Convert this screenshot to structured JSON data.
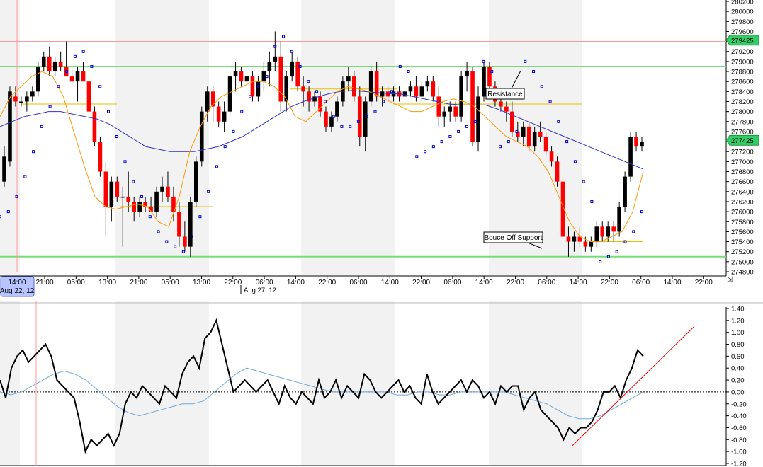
{
  "colors": {
    "bull": "#000000",
    "bear": "#ff0000",
    "ma_slow": "#3333cc",
    "ma_fast": "#ff9900",
    "sar": "#0000cc",
    "support_resistance": "#77dd77",
    "top_line": "#ff8888",
    "level_lines": "#e6c200",
    "oscillator": "#000000",
    "oscillator_signal": "#6fa8dc",
    "trendline": "#ff0000",
    "marker_bg": "#b8c4ff",
    "price_tag_bg": "#33cc66",
    "band": "#f2f2f2"
  },
  "price_panel": {
    "y_ticks": [
      "280200",
      "280000",
      "279800",
      "279600",
      "279400",
      "279200",
      "279000",
      "278800",
      "278600",
      "278400",
      "278200",
      "278000",
      "277800",
      "277600",
      "277400",
      "277200",
      "277000",
      "276800",
      "276600",
      "276400",
      "276200",
      "276000",
      "275800",
      "275600",
      "275400",
      "275200",
      "275000",
      "274800"
    ],
    "price_tags": [
      "279425",
      "277425"
    ],
    "x_ticks": [
      "21:00",
      "05:00",
      "13:00",
      "21:00",
      "05:00",
      "13:00",
      "22:00",
      "06:00",
      "14:00",
      "22:00",
      "06:00",
      "14:00",
      "22:00",
      "06:00",
      "14:00",
      "22:00",
      "06:00",
      "14:00",
      "22:00",
      "06:00",
      "14:00",
      "22:00"
    ],
    "date_marker": "14:00\nAug 22, 12",
    "date_label": "Aug 27, 12",
    "annotations": [
      "Resistance",
      "Bouce Off Support"
    ]
  },
  "osc_panel": {
    "y_ticks": [
      "1.40",
      "1.20",
      "1.00",
      "0.80",
      "0.60",
      "0.40",
      "0.20",
      "0.00",
      "-0.20",
      "-0.40",
      "-0.60",
      "-0.80",
      "-1.00",
      "-1.20"
    ]
  },
  "chart_data": [
    {
      "type": "candlestick",
      "ylim": [
        274800,
        280200
      ],
      "levels": {
        "resistance": 278900,
        "support": 275100,
        "top_line": 279400
      },
      "candles": [
        [
          276600,
          277300,
          276500,
          277100
        ],
        [
          277000,
          278500,
          276900,
          278400
        ],
        [
          278300,
          278500,
          278100,
          278200
        ],
        [
          278200,
          278300,
          278100,
          278200
        ],
        [
          278200,
          278400,
          278000,
          278300
        ],
        [
          278300,
          278500,
          278200,
          278400
        ],
        [
          278400,
          279000,
          278300,
          278900
        ],
        [
          278900,
          279200,
          278800,
          279100
        ],
        [
          279100,
          279300,
          278700,
          278800
        ],
        [
          278800,
          279100,
          278700,
          279000
        ],
        [
          279000,
          279200,
          278800,
          278900
        ],
        [
          278900,
          279400,
          278800,
          278700
        ],
        [
          278700,
          278900,
          278500,
          278600
        ],
        [
          278600,
          278900,
          278200,
          278800
        ],
        [
          278800,
          279000,
          278700,
          278600
        ],
        [
          278600,
          278800,
          277900,
          278000
        ],
        [
          278000,
          278100,
          277300,
          277400
        ],
        [
          277400,
          277500,
          276700,
          276800
        ],
        [
          276800,
          277000,
          275500,
          276100
        ],
        [
          276100,
          276700,
          275800,
          276600
        ],
        [
          276600,
          276700,
          276200,
          276300
        ],
        [
          276300,
          276500,
          275300,
          276300
        ],
        [
          276300,
          276800,
          276000,
          276200
        ],
        [
          276200,
          276300,
          275800,
          276000
        ],
        [
          276000,
          276300,
          275900,
          276200
        ],
        [
          276200,
          276300,
          276000,
          276100
        ],
        [
          276100,
          276300,
          276000,
          276000
        ],
        [
          276000,
          276500,
          275900,
          276400
        ],
        [
          276400,
          276700,
          276200,
          276500
        ],
        [
          276500,
          276800,
          276200,
          276300
        ],
        [
          276300,
          276500,
          275800,
          276000
        ],
        [
          276000,
          276200,
          275300,
          275500
        ],
        [
          275500,
          275800,
          275200,
          275300
        ],
        [
          275300,
          276300,
          275100,
          276200
        ],
        [
          276200,
          277100,
          276100,
          277000
        ],
        [
          277000,
          278100,
          276900,
          278000
        ],
        [
          278000,
          278500,
          277800,
          278400
        ],
        [
          278400,
          278500,
          277800,
          278100
        ],
        [
          278100,
          278200,
          277700,
          277800
        ],
        [
          277800,
          278200,
          277600,
          278000
        ],
        [
          278000,
          278800,
          277900,
          278700
        ],
        [
          278700,
          279000,
          278400,
          278800
        ],
        [
          278800,
          278900,
          278500,
          278600
        ],
        [
          278600,
          278900,
          278400,
          278700
        ],
        [
          278700,
          278800,
          278200,
          278300
        ],
        [
          278300,
          278700,
          278200,
          278600
        ],
        [
          278600,
          279000,
          278400,
          278800
        ],
        [
          278800,
          279200,
          278500,
          279000
        ],
        [
          279000,
          279600,
          278800,
          279100
        ],
        [
          279100,
          279400,
          278000,
          278200
        ],
        [
          278200,
          278800,
          278000,
          278700
        ],
        [
          278700,
          279200,
          278600,
          279000
        ],
        [
          279000,
          279100,
          278400,
          278500
        ],
        [
          278500,
          278700,
          278100,
          278400
        ],
        [
          278400,
          278500,
          278000,
          278200
        ],
        [
          278200,
          278400,
          278100,
          278300
        ],
        [
          278300,
          278400,
          277900,
          278000
        ],
        [
          278000,
          278100,
          277600,
          277700
        ],
        [
          277700,
          278000,
          277600,
          277900
        ],
        [
          277900,
          278300,
          277800,
          278200
        ],
        [
          278200,
          278700,
          278100,
          278600
        ],
        [
          278600,
          278900,
          278400,
          278700
        ],
        [
          278700,
          278800,
          278200,
          278300
        ],
        [
          278300,
          278500,
          277300,
          277500
        ],
        [
          277500,
          278300,
          277200,
          278200
        ],
        [
          278200,
          278900,
          278100,
          278800
        ],
        [
          278800,
          279000,
          278200,
          278300
        ],
        [
          278300,
          278500,
          278100,
          278400
        ],
        [
          278400,
          278500,
          278200,
          278300
        ],
        [
          278300,
          278500,
          278200,
          278400
        ],
        [
          278400,
          278500,
          278200,
          278300
        ],
        [
          278300,
          278400,
          278200,
          278400
        ],
        [
          278400,
          278600,
          278300,
          278500
        ],
        [
          278500,
          278700,
          278200,
          278300
        ],
        [
          278300,
          278600,
          278200,
          278500
        ],
        [
          278500,
          278700,
          278400,
          278600
        ],
        [
          278600,
          278700,
          278200,
          278300
        ],
        [
          278300,
          278500,
          277700,
          277900
        ],
        [
          277900,
          278100,
          277700,
          278000
        ],
        [
          278000,
          278200,
          277800,
          278100
        ],
        [
          278100,
          278200,
          277800,
          277900
        ],
        [
          277900,
          278800,
          277800,
          278700
        ],
        [
          278700,
          279000,
          278400,
          278800
        ],
        [
          278800,
          278900,
          277300,
          277400
        ],
        [
          277400,
          278500,
          277200,
          278300
        ],
        [
          278300,
          279000,
          278200,
          278900
        ],
        [
          278900,
          279000,
          278400,
          278500
        ],
        [
          278500,
          278600,
          278100,
          278200
        ],
        [
          278200,
          278300,
          278000,
          278100
        ],
        [
          278100,
          278200,
          277800,
          278000
        ],
        [
          278000,
          278200,
          277500,
          277600
        ],
        [
          277600,
          277800,
          277400,
          277500
        ],
        [
          277500,
          277800,
          277300,
          277700
        ],
        [
          277700,
          277800,
          277200,
          277300
        ],
        [
          277300,
          277700,
          277200,
          277600
        ],
        [
          277600,
          277800,
          277400,
          277500
        ],
        [
          277500,
          277600,
          277100,
          277200
        ],
        [
          277200,
          277300,
          276900,
          277000
        ],
        [
          277000,
          277100,
          276500,
          276600
        ],
        [
          276600,
          276700,
          275300,
          275500
        ],
        [
          275500,
          275700,
          275100,
          275400
        ],
        [
          275400,
          275600,
          275200,
          275500
        ],
        [
          275500,
          275700,
          275300,
          275400
        ],
        [
          275400,
          275500,
          275200,
          275300
        ],
        [
          275300,
          275500,
          275200,
          275400
        ],
        [
          275400,
          275800,
          275300,
          275700
        ],
        [
          275700,
          275800,
          275400,
          275500
        ],
        [
          275500,
          275800,
          275400,
          275700
        ],
        [
          275700,
          275800,
          275400,
          275600
        ],
        [
          275600,
          276200,
          275500,
          276100
        ],
        [
          276100,
          276800,
          276000,
          276700
        ],
        [
          276700,
          277600,
          276600,
          277500
        ],
        [
          277500,
          277600,
          277200,
          277300
        ],
        [
          277300,
          277500,
          277200,
          277400
        ]
      ],
      "ma_slow": [
        277700,
        277800,
        277900,
        277950,
        278000,
        278000,
        277950,
        277900,
        277850,
        277750,
        277600,
        277450,
        277300,
        277250,
        277200,
        277200,
        277200,
        277250,
        277300,
        277400,
        277500,
        277650,
        277800,
        277950,
        278100,
        278200,
        278280,
        278350,
        278400,
        278420,
        278400,
        278380,
        278360,
        278350,
        278300,
        278250,
        278200,
        278150,
        278130,
        278130,
        278130,
        278050,
        277950,
        277850,
        277750,
        277650,
        277550,
        277450,
        277350,
        277250,
        277150,
        277050,
        276950,
        276850
      ],
      "ma_fast": [
        277900,
        278300,
        278500,
        278700,
        278800,
        278700,
        278300,
        277600,
        276900,
        276300,
        276100,
        276050,
        276100,
        276150,
        276100,
        275800,
        275700,
        276300,
        277200,
        277700,
        278100,
        278300,
        278400,
        278500,
        278600,
        278600,
        278500,
        278300,
        277900,
        277800,
        278000,
        278200,
        278400,
        278500,
        278450,
        278400,
        278300,
        278200,
        278100,
        278000,
        278000,
        278100,
        278200,
        278250,
        278200,
        278100,
        277900,
        277700,
        277500,
        277400,
        277300,
        277100,
        276800,
        276300,
        275800,
        275500,
        275400,
        275400,
        275500,
        275600,
        276000,
        276800
      ],
      "sar": [
        275900,
        276000,
        276300,
        276700,
        277200,
        277700,
        278100,
        278500,
        278800,
        279100,
        279200,
        278900,
        278500,
        278000,
        277500,
        277000,
        276600,
        276300,
        275900,
        275600,
        275400,
        275300,
        275200,
        275500,
        275900,
        276400,
        276900,
        277300,
        277600,
        278000,
        278300,
        278500,
        278700,
        279300,
        279500,
        279200,
        278900,
        278600,
        278400,
        278200,
        277900,
        277700,
        277700,
        277800,
        277900,
        278000,
        278200,
        278400,
        278900,
        278800,
        277100,
        277200,
        277300,
        277400,
        277500,
        277600,
        277700,
        277800,
        279000,
        278800,
        277300,
        277400,
        277600,
        279000,
        278800,
        278500,
        278200,
        277800,
        277400,
        277000,
        276600,
        276200,
        275000,
        275100,
        275200,
        275400,
        275600,
        276000
      ]
    },
    {
      "type": "line",
      "ylim": [
        -1.2,
        1.4
      ],
      "series": [
        {
          "values": [
            0.2,
            -0.1,
            0.4,
            0.6,
            0.7,
            0.5,
            0.6,
            0.7,
            0.8,
            0.6,
            0.2,
            0.1,
            0.0,
            -0.1,
            -0.5,
            -1.0,
            -0.8,
            -0.9,
            -0.8,
            -0.7,
            -0.9,
            -0.7,
            -0.2,
            0.0,
            -0.1,
            0.1,
            0.0,
            -0.1,
            -0.2,
            0.1,
            0.0,
            -0.1,
            0.3,
            0.5,
            0.6,
            0.4,
            0.9,
            1.0,
            1.2,
            0.8,
            0.4,
            0.0,
            0.1,
            0.2,
            0.1,
            0.0,
            0.1,
            0.2,
            0.0,
            -0.2,
            0.1,
            -0.1,
            -0.2,
            0.0,
            -0.1,
            -0.2,
            0.2,
            -0.1,
            0.0,
            0.2,
            -0.1,
            0.1,
            0.0,
            -0.1,
            0.3,
            0.2,
            0.0,
            -0.1,
            0.0,
            0.1,
            0.2,
            0.0,
            0.1,
            -0.1,
            -0.2,
            0.3,
            0.0,
            -0.2,
            -0.1,
            0.0,
            0.1,
            0.2,
            0.0,
            0.2,
            0.1,
            -0.1,
            0.0,
            -0.2,
            0.1,
            0.0,
            0.1,
            0.1,
            -0.3,
            -0.1,
            0.0,
            -0.3,
            -0.4,
            -0.5,
            -0.6,
            -0.8,
            -0.6,
            -0.7,
            -0.6,
            -0.6,
            -0.5,
            -0.3,
            0.0,
            0.0,
            0.1,
            -0.1,
            0.2,
            0.4,
            0.7,
            0.6
          ]
        },
        {
          "values": [
            0.0,
            -0.05,
            0.0,
            0.1,
            0.2,
            0.3,
            0.35,
            0.3,
            0.2,
            0.05,
            -0.1,
            -0.25,
            -0.35,
            -0.4,
            -0.35,
            -0.3,
            -0.25,
            -0.2,
            -0.2,
            -0.15,
            0.0,
            0.15,
            0.3,
            0.4,
            0.35,
            0.3,
            0.25,
            0.2,
            0.15,
            0.1,
            0.05,
            0.0,
            0.0,
            0.0,
            0.0,
            0.0,
            0.0,
            -0.05,
            -0.05,
            0.0,
            0.0,
            -0.05,
            -0.05,
            0.0,
            0.0,
            0.0,
            0.0,
            0.0,
            -0.05,
            -0.1,
            -0.15,
            -0.2,
            -0.3,
            -0.4,
            -0.45,
            -0.45,
            -0.4,
            -0.3,
            -0.2,
            -0.1,
            0.0
          ]
        }
      ],
      "trendline": [
        [
          -0.9,
          1.1
        ]
      ]
    }
  ]
}
